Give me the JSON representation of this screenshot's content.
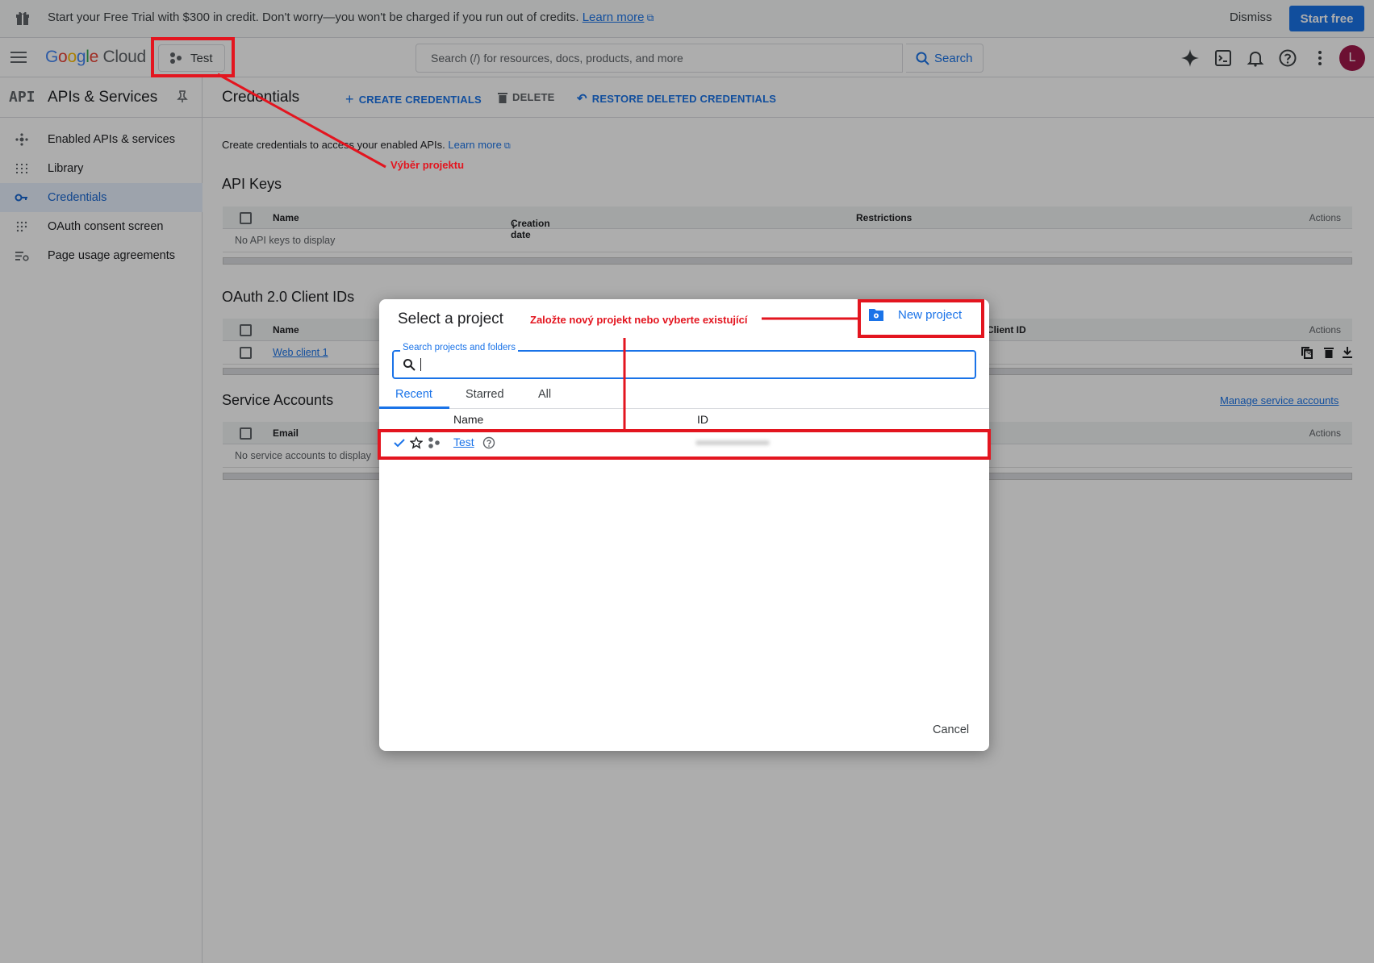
{
  "banner": {
    "message": "Start your Free Trial with $300 in credit. Don't worry—you won't be charged if you run out of credits.",
    "learn_more": "Learn more",
    "dismiss": "Dismiss",
    "start_free": "Start free"
  },
  "topbar": {
    "logo_g1": "G",
    "logo_o1": "o",
    "logo_o2": "o",
    "logo_g2": "g",
    "logo_l": "l",
    "logo_e": "e",
    "logo_cloud": "Cloud",
    "project": "Test",
    "search_placeholder": "Search (/) for resources, docs, products, and more",
    "search_button": "Search",
    "avatar_letter": "L"
  },
  "sidebar": {
    "api_badge": "API",
    "title": "APIs & Services",
    "items": [
      {
        "label": "Enabled APIs & services",
        "icon": "hub-icon"
      },
      {
        "label": "Library",
        "icon": "library-icon"
      },
      {
        "label": "Credentials",
        "icon": "key-icon",
        "active": true
      },
      {
        "label": "OAuth consent screen",
        "icon": "consent-icon"
      },
      {
        "label": "Page usage agreements",
        "icon": "settings-list-icon"
      }
    ]
  },
  "main": {
    "title": "Credentials",
    "actions": {
      "create": "CREATE CREDENTIALS",
      "delete": "DELETE",
      "restore": "RESTORE DELETED CREDENTIALS"
    },
    "description": "Create credentials to access your enabled APIs.",
    "learn_more": "Learn more",
    "api_keys": {
      "title": "API Keys",
      "columns": [
        "Name",
        "Creation date",
        "Restrictions",
        "Actions"
      ],
      "empty": "No API keys to display"
    },
    "oauth": {
      "title": "OAuth 2.0 Client IDs",
      "columns": [
        "Name",
        "Client ID",
        "Actions"
      ],
      "rows": [
        {
          "name": "Web client 1"
        }
      ]
    },
    "service_accounts": {
      "title": "Service Accounts",
      "manage": "Manage service accounts",
      "columns": [
        "Email",
        "Actions"
      ],
      "empty": "No service accounts to display"
    }
  },
  "dialog": {
    "title": "Select a project",
    "new_project": "New project",
    "search_label": "Search projects and folders",
    "tabs": [
      "Recent",
      "Starred",
      "All"
    ],
    "columns": [
      "Name",
      "ID"
    ],
    "rows": [
      {
        "name": "Test"
      }
    ],
    "cancel": "Cancel"
  },
  "annotations": {
    "project_selector": "Výběr projektu",
    "new_or_existing": "Založte nový projekt nebo vyberte existující"
  },
  "colors": {
    "accent": "#1a73e8",
    "annotation": "#e3151f",
    "avatar": "#a0194b"
  }
}
